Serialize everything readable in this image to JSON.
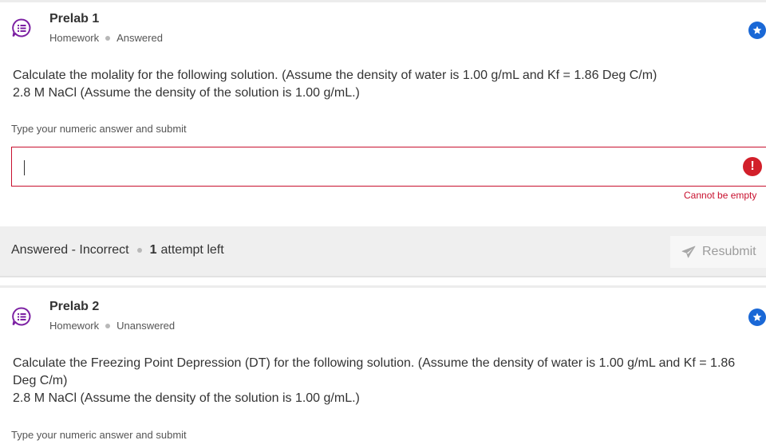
{
  "questions": [
    {
      "title": "Prelab 1",
      "type": "Homework",
      "status": "Answered",
      "text_line1": "Calculate the molality for the following solution. (Assume the density of water is 1.00 g/mL and Kf = 1.86 Deg C/m)",
      "text_line2": "2.8 M NaCl (Assume the density of the solution is 1.00 g/mL.)",
      "answer_hint": "Type your numeric answer and submit",
      "answer_value": "",
      "error_message": "Cannot be empty",
      "result_status": "Answered - Incorrect",
      "attempts_count": "1",
      "attempts_label": "attempt left",
      "resubmit_label": "Resubmit"
    },
    {
      "title": "Prelab 2",
      "type": "Homework",
      "status": "Unanswered",
      "text_line1": "Calculate the Freezing Point Depression (DT) for the following solution. (Assume the density of water is 1.00 g/mL and Kf = 1.86 Deg C/m)",
      "text_line2": "2.8 M NaCl (Assume the density of the solution is 1.00 g/mL.)",
      "answer_hint": "Type your numeric answer and submit"
    }
  ],
  "icons": {
    "question_icon": "chat-bubble-list-icon",
    "bookmark_icon": "star-icon",
    "error_icon": "exclamation-icon",
    "resubmit_icon": "send-arrow-icon"
  },
  "colors": {
    "accent": "#1a68d6",
    "icon_purple": "#7b1fa2",
    "error": "#c8102e",
    "status_bar": "#efefef"
  }
}
